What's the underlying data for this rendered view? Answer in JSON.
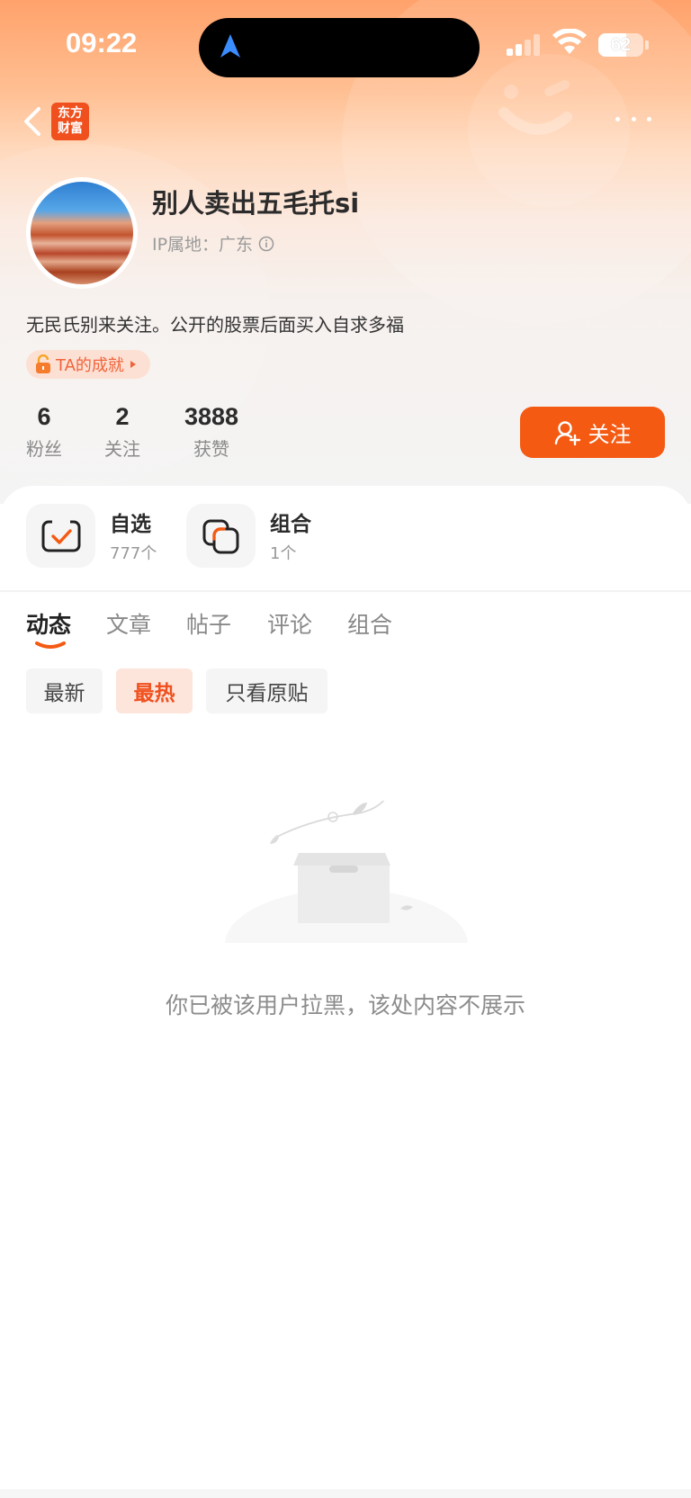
{
  "status_bar": {
    "time": "09:22",
    "battery": "62",
    "battery_level": 0.62
  },
  "header": {
    "app_logo_line1": "东方",
    "app_logo_line2": "财富"
  },
  "profile": {
    "username": "别人卖出五毛托si",
    "ip_location": "IP属地：广东",
    "bio": "无民氏别来关注。公开的股票后面买入自求多福",
    "achievement": "TA的成就"
  },
  "stats": [
    {
      "value": "6",
      "label": "粉丝"
    },
    {
      "value": "2",
      "label": "关注"
    },
    {
      "value": "3888",
      "label": "获赞"
    }
  ],
  "follow_button": "关注",
  "quick_links": [
    {
      "title": "自选",
      "sub": "777个"
    },
    {
      "title": "组合",
      "sub": "1个"
    }
  ],
  "tabs": [
    "动态",
    "文章",
    "帖子",
    "评论",
    "组合"
  ],
  "active_tab": "动态",
  "filters": [
    "最新",
    "最热",
    "只看原贴"
  ],
  "active_filter": "最热",
  "empty_state": {
    "message": "你已被该用户拉黑，该处内容不展示"
  },
  "colors": {
    "accent": "#f55a12",
    "header_gradient_top": "#ffa26b"
  }
}
